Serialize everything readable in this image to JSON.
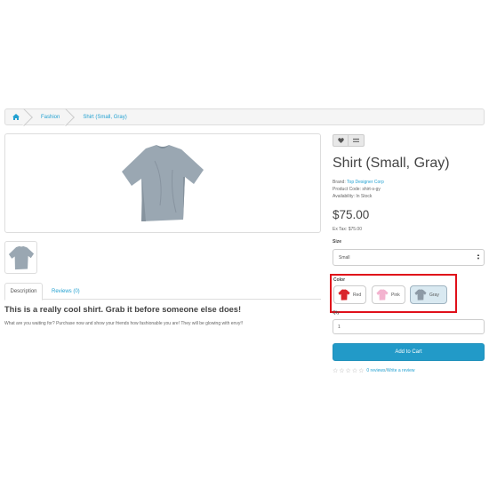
{
  "breadcrumb": {
    "items": [
      "Fashion",
      "Shirt (Small, Gray)"
    ]
  },
  "icons": {
    "home": "home-icon",
    "wishlist": "heart-icon",
    "compare": "compare-icon",
    "stars": "star-icon"
  },
  "tabs": {
    "description": "Description",
    "reviews": "Reviews (0)"
  },
  "description": {
    "title": "This is a really cool shirt. Grab it before someone else does!",
    "text": "What are you waiting for? Purchase now and show your friends how fashionable you are! They will be glowing with envy!!"
  },
  "product": {
    "title": "Shirt (Small, Gray)",
    "brand_label": "Brand:",
    "brand_value": "Top Designer Corp",
    "code_label": "Product Code:",
    "code_value": "shirt-s-gy",
    "availability_label": "Availability:",
    "availability_value": "In Stock",
    "price": "$75.00",
    "ex_tax": "Ex Tax: $75.00"
  },
  "options": {
    "size_label": "Size",
    "size_value": "Small",
    "color_label": "Color",
    "colors": [
      {
        "label": "Red",
        "hex": "#d9262c"
      },
      {
        "label": "Pink",
        "hex": "#f3b3cf"
      },
      {
        "label": "Gray",
        "hex": "#8d9aa6"
      }
    ],
    "selected_color": "Gray",
    "qty_label": "Qty",
    "qty_value": "1"
  },
  "actions": {
    "add_to_cart": "Add to Cart"
  },
  "reviews": {
    "count_link": "0 reviews",
    "separator": " / ",
    "write_link": "Write a review"
  },
  "colors": {
    "accent": "#229ac8",
    "link": "#23a1d1",
    "highlight_box": "#e0101a"
  }
}
